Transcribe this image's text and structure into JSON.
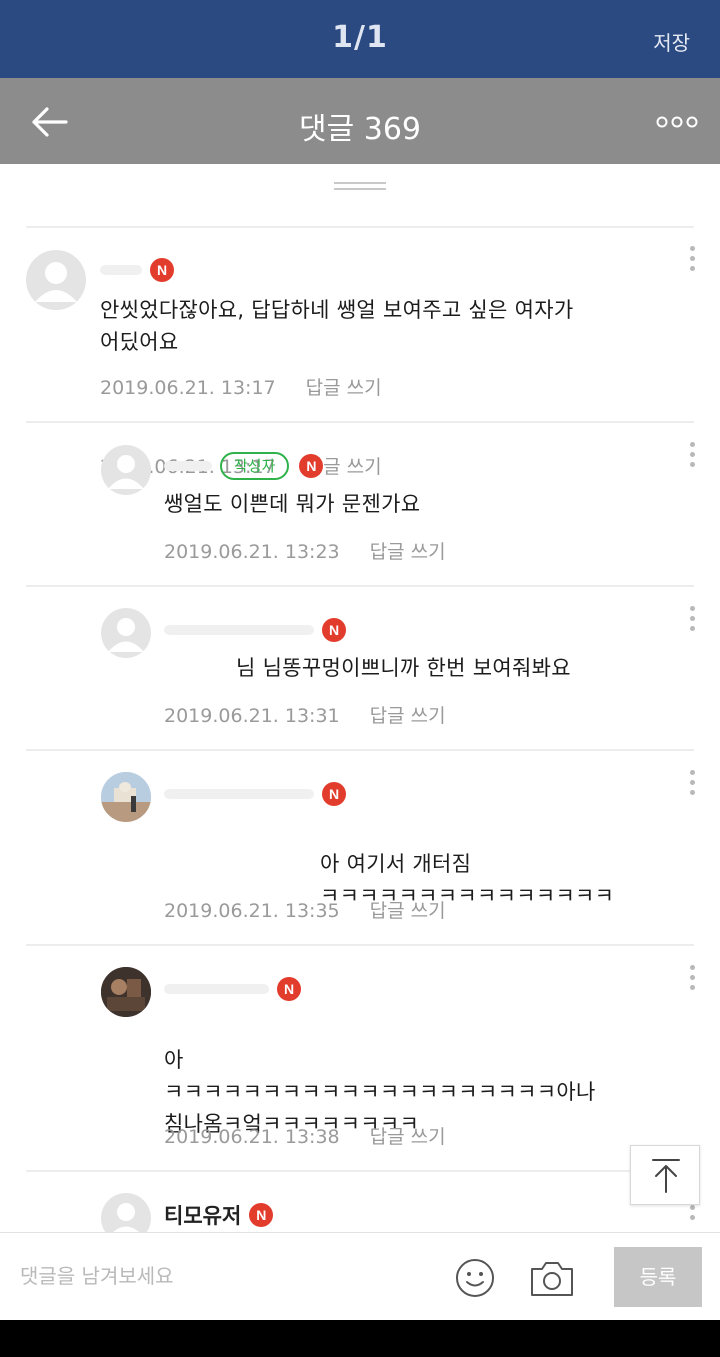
{
  "viewer": {
    "page_counter": "1/1",
    "save_label": "저장"
  },
  "header": {
    "title": "댓글 369",
    "back_icon": "arrow-left-icon",
    "more_icon": "more-dots-icon"
  },
  "comments": [
    {
      "author": "",
      "is_writer": false,
      "badge": "N",
      "text": "안씻었다잖아요, 답답하네 쌩얼 보여주고 싶은 여자가\n어딨어요",
      "date": "2019.06.21. 13:17",
      "reply_label": "답글 쓰기"
    },
    {
      "author": "",
      "is_writer": true,
      "writer_badge": "작성자",
      "badge": "N",
      "text": "쌩얼도 이쁜데 뭐가 문젠가요",
      "date": "2019.06.21. 13:23",
      "reply_label": "답글 쓰기"
    },
    {
      "author": "",
      "is_writer": false,
      "badge": "N",
      "text": "님 님똥꾸멍이쁘니까 한번 보여줘봐요",
      "date": "2019.06.21. 13:31",
      "reply_label": "답글 쓰기"
    },
    {
      "author": "",
      "is_writer": false,
      "badge": "N",
      "text": "아 여기서 개터짐\nㅋㅋㅋㅋㅋㅋㅋㅋㅋㅋㅋㅋㅋㅋㅋ",
      "date": "2019.06.21. 13:35",
      "reply_label": "답글 쓰기"
    },
    {
      "author": "",
      "is_writer": false,
      "badge": "N",
      "text": "아\nㅋㅋㅋㅋㅋㅋㅋㅋㅋㅋㅋㅋㅋㅋㅋㅋㅋㅋㅋㅋ아나\n침나옴ㅋ엌ㅋㅋㅋㅋㅋㅋㅋㅋ",
      "date": "2019.06.21. 13:38",
      "reply_label": "답글 쓰기"
    },
    {
      "author": "티모유저",
      "is_writer": false,
      "badge": "N"
    }
  ],
  "compose": {
    "placeholder": "댓글을 남겨보세요",
    "submit_label": "등록",
    "emoji_icon": "smiley-icon",
    "camera_icon": "camera-icon"
  },
  "colors": {
    "viewer_bar": "#2b4a82",
    "header_bar": "#8c8c8c",
    "writer_badge": "#2fb24a",
    "new_badge": "#e23c2c"
  }
}
